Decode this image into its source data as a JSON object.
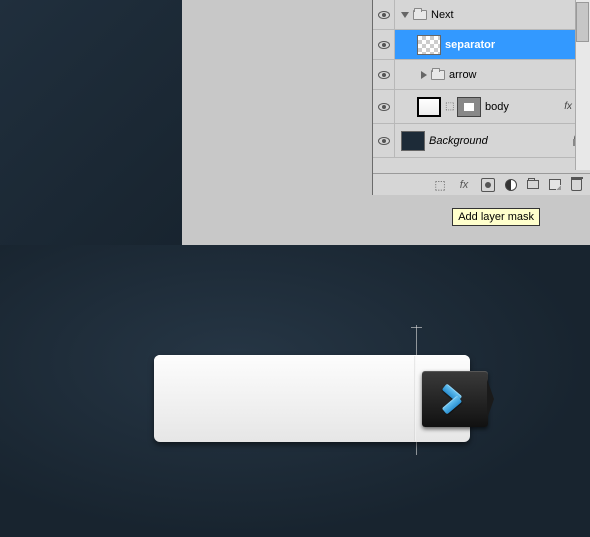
{
  "layers_panel": {
    "rows": [
      {
        "name": "Next",
        "type": "group",
        "expanded": true,
        "indent": 0
      },
      {
        "name": "separator",
        "type": "layer",
        "selected": true,
        "indent": 1
      },
      {
        "name": "arrow",
        "type": "group",
        "expanded": false,
        "indent": 1
      },
      {
        "name": "body",
        "type": "layer-mask",
        "fx": true,
        "indent": 1
      },
      {
        "name": "Background",
        "type": "bg",
        "locked": true,
        "indent": 0
      }
    ],
    "footer_icons": [
      "link",
      "fx",
      "mask",
      "adjust",
      "group",
      "new",
      "trash"
    ],
    "fx_text": "fx"
  },
  "tooltip": {
    "text": "Add layer mask"
  }
}
